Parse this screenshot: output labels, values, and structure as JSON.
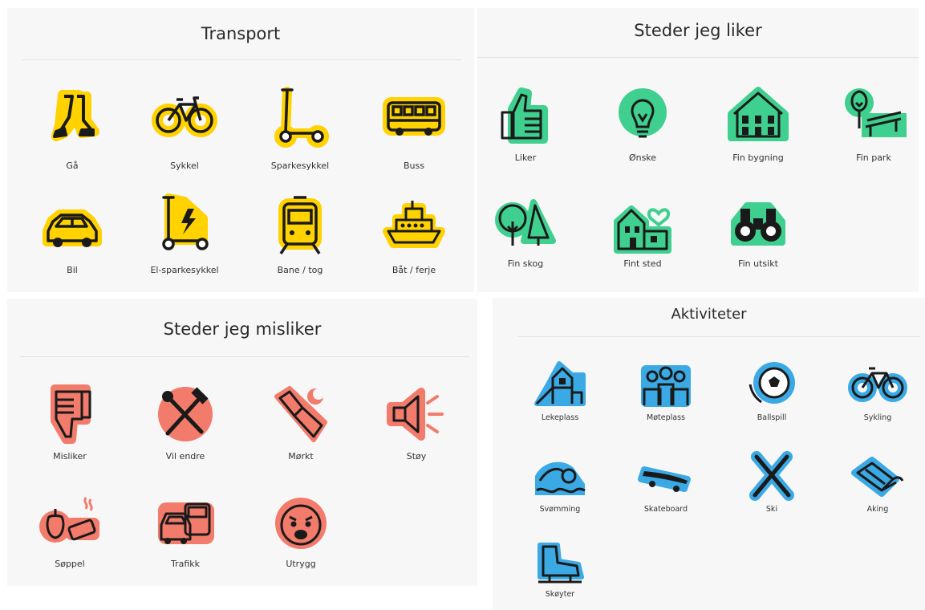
{
  "colors": {
    "transport": "#ffd200",
    "liker": "#3fcf8e",
    "misliker": "#f27b6b",
    "aktiviteter": "#3ba9e4",
    "ink": "#1a1a1a"
  },
  "panels": {
    "transport": {
      "title": "Transport",
      "items": [
        {
          "label": "Gå",
          "icon": "walking-legs-icon"
        },
        {
          "label": "Sykkel",
          "icon": "bicycle-icon"
        },
        {
          "label": "Sparkesykkel",
          "icon": "kick-scooter-icon"
        },
        {
          "label": "Buss",
          "icon": "bus-icon"
        },
        {
          "label": "Bil",
          "icon": "car-icon"
        },
        {
          "label": "El-sparkesykkel",
          "icon": "electric-scooter-icon"
        },
        {
          "label": "Bane / tog",
          "icon": "train-icon"
        },
        {
          "label": "Båt / ferje",
          "icon": "ferry-icon"
        }
      ]
    },
    "liker": {
      "title": "Steder jeg liker",
      "items": [
        {
          "label": "Liker",
          "icon": "thumbs-up-icon"
        },
        {
          "label": "Ønske",
          "icon": "lightbulb-icon"
        },
        {
          "label": "Fin bygning",
          "icon": "building-icon"
        },
        {
          "label": "Fin park",
          "icon": "park-bench-icon"
        },
        {
          "label": "Fin skog",
          "icon": "forest-icon"
        },
        {
          "label": "Fint sted",
          "icon": "house-heart-icon"
        },
        {
          "label": "Fin utsikt",
          "icon": "binoculars-icon"
        }
      ]
    },
    "misliker": {
      "title": "Steder jeg misliker",
      "items": [
        {
          "label": "Misliker",
          "icon": "thumbs-down-icon"
        },
        {
          "label": "Vil endre",
          "icon": "hammer-wrench-icon"
        },
        {
          "label": "Mørkt",
          "icon": "flashlight-moon-icon"
        },
        {
          "label": "Støy",
          "icon": "loudspeaker-icon"
        },
        {
          "label": "Søppel",
          "icon": "trash-apple-can-icon"
        },
        {
          "label": "Trafikk",
          "icon": "traffic-cars-icon"
        },
        {
          "label": "Utrygg",
          "icon": "scared-face-icon"
        }
      ]
    },
    "aktiviteter": {
      "title": "Aktiviteter",
      "items": [
        {
          "label": "Lekeplass",
          "icon": "playground-icon"
        },
        {
          "label": "Møteplass",
          "icon": "meeting-people-icon"
        },
        {
          "label": "Ballspill",
          "icon": "soccer-ball-icon"
        },
        {
          "label": "Sykling",
          "icon": "bicycle-icon"
        },
        {
          "label": "Svømming",
          "icon": "swimmer-icon"
        },
        {
          "label": "Skateboard",
          "icon": "skateboard-icon"
        },
        {
          "label": "Ski",
          "icon": "crossed-skis-icon"
        },
        {
          "label": "Aking",
          "icon": "sled-icon"
        },
        {
          "label": "Skøyter",
          "icon": "ice-skate-icon"
        }
      ]
    }
  }
}
